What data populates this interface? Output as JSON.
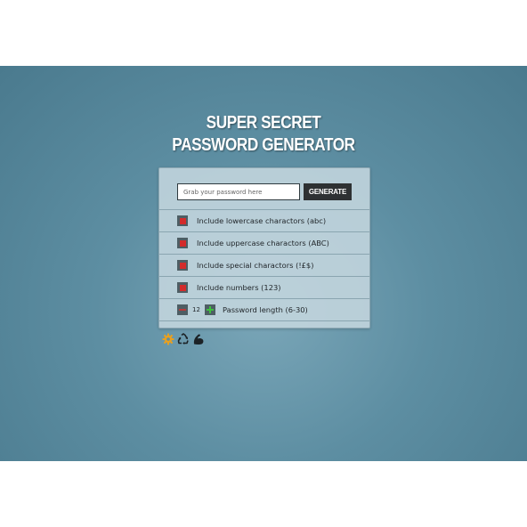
{
  "title": {
    "line1": "SUPER SECRET",
    "line2": "PASSWORD GENERATOR"
  },
  "password": {
    "placeholder": "Grab your password here",
    "value": ""
  },
  "generate_label": "GENERATE",
  "options": [
    {
      "label": "Include lowercase charactors (abc)",
      "checked": true
    },
    {
      "label": "Include uppercase charactors (ABC)",
      "checked": true
    },
    {
      "label": "Include special charactors (!£$)",
      "checked": true
    },
    {
      "label": "Include numbers (123)",
      "checked": true
    }
  ],
  "length": {
    "value": "12",
    "label": "Password length (6-30)"
  },
  "toolbar_icons": [
    "gear-icon",
    "recycle-icon",
    "strength-arm-icon"
  ],
  "colors": {
    "background": "#5d8ea2",
    "panel": "#c4d6de",
    "checkbox_mark": "#d32b2b",
    "plus": "#3fbf3f",
    "gear": "#e8a020",
    "button": "#2e3133"
  }
}
